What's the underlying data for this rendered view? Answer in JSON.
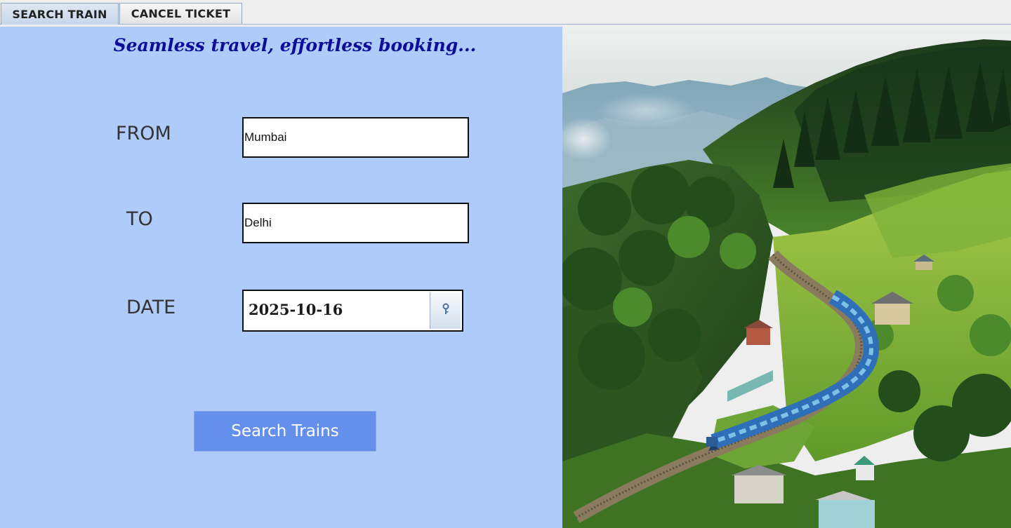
{
  "tabs": [
    {
      "label": "SEARCH TRAIN",
      "active": true
    },
    {
      "label": "CANCEL TICKET",
      "active": false
    }
  ],
  "search_panel": {
    "tagline": "Seamless travel, effortless booking...",
    "from_label": "FROM",
    "from_value": "Mumbai",
    "to_label": "TO",
    "to_value": "Delhi",
    "date_label": "DATE",
    "date_value": "2025-10-16",
    "search_button_label": "Search Trains"
  },
  "icons": {
    "date_picker": "calendar-key-icon"
  },
  "colors": {
    "panel_background": "#aecbfa",
    "tagline": "#0d0d9a",
    "button_background": "#6490ec",
    "button_text": "#ffffff"
  },
  "image": {
    "subject": "blue passenger train winding through green forested hills with misty mountains"
  }
}
